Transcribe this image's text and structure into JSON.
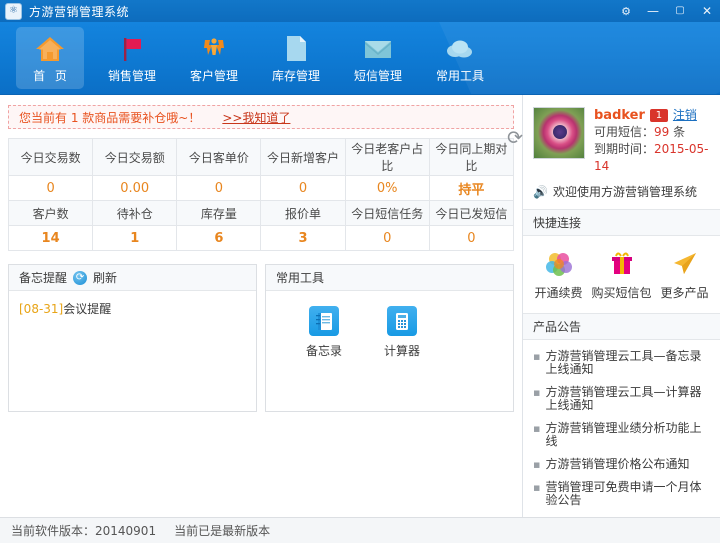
{
  "window": {
    "title": "方游营销管理系统",
    "app_icon": "shield-icon",
    "controls": {
      "settings": "⚙",
      "minimize": "—",
      "maximize": "▢",
      "close": "✕"
    }
  },
  "nav": {
    "items": [
      {
        "label": "首 页",
        "icon": "home-icon",
        "active": true
      },
      {
        "label": "销售管理",
        "icon": "flag-icon",
        "active": false
      },
      {
        "label": "客户管理",
        "icon": "users-icon",
        "active": false
      },
      {
        "label": "库存管理",
        "icon": "document-icon",
        "active": false
      },
      {
        "label": "短信管理",
        "icon": "envelope-icon",
        "active": false
      },
      {
        "label": "常用工具",
        "icon": "cloud-icon",
        "active": false
      }
    ]
  },
  "alert": {
    "text": "您当前有 1 款商品需要补仓哦~！",
    "link": ">>我知道了"
  },
  "stats": {
    "reload_icon": "refresh-circle-icon",
    "row1_headers": [
      "今日交易数",
      "今日交易额",
      "今日客单价",
      "今日新增客户",
      "今日老客户占比",
      "今日同上期对比"
    ],
    "row1_values": [
      "0",
      "0.00",
      "0",
      "0",
      "0%",
      "持平"
    ],
    "row2_headers": [
      "客户数",
      "待补仓",
      "库存量",
      "报价单",
      "今日短信任务",
      "今日已发短信"
    ],
    "row2_values": [
      "14",
      "1",
      "6",
      "3",
      "0",
      "0"
    ]
  },
  "memo": {
    "title": "备忘提醒",
    "refresh_label": "刷新",
    "items": [
      {
        "date": "[08-31]",
        "text": "会议提醒"
      }
    ]
  },
  "tools": {
    "title": "常用工具",
    "items": [
      {
        "label": "备忘录",
        "icon": "notebook-icon"
      },
      {
        "label": "计算器",
        "icon": "calculator-icon"
      }
    ]
  },
  "sidebar": {
    "user": {
      "name": "badker",
      "badge": "1",
      "logout": "注销",
      "sms_label": "可用短信：",
      "sms_value": "99",
      "sms_unit": " 条",
      "expire_label": "到期时间：",
      "expire_value": "2015-05-14",
      "avatar": "flower-avatar"
    },
    "welcome": {
      "icon": "megaphone-icon",
      "text": "欢迎使用方游营销管理系统"
    },
    "quick_links": {
      "title": "快捷连接",
      "items": [
        {
          "label": "开通续费",
          "icon": "color-circles-icon"
        },
        {
          "label": "购买短信包",
          "icon": "gift-icon"
        },
        {
          "label": "更多产品",
          "icon": "paper-plane-icon"
        }
      ]
    },
    "notices": {
      "title": "产品公告",
      "items": [
        "方游营销管理云工具—备忘录上线通知",
        "方游营销管理云工具—计算器上线通知",
        "方游营销管理业绩分析功能上线",
        "方游营销管理价格公布通知",
        "营销管理可免费申请一个月体验公告"
      ]
    }
  },
  "statusbar": {
    "version": "当前软件版本：20140901",
    "update": "当前已是最新版本"
  },
  "colors": {
    "nav_blue": "#0e79d2",
    "accent_orange": "#e8861f",
    "alert_red": "#e8521f",
    "link_blue": "#1b6fc0"
  }
}
